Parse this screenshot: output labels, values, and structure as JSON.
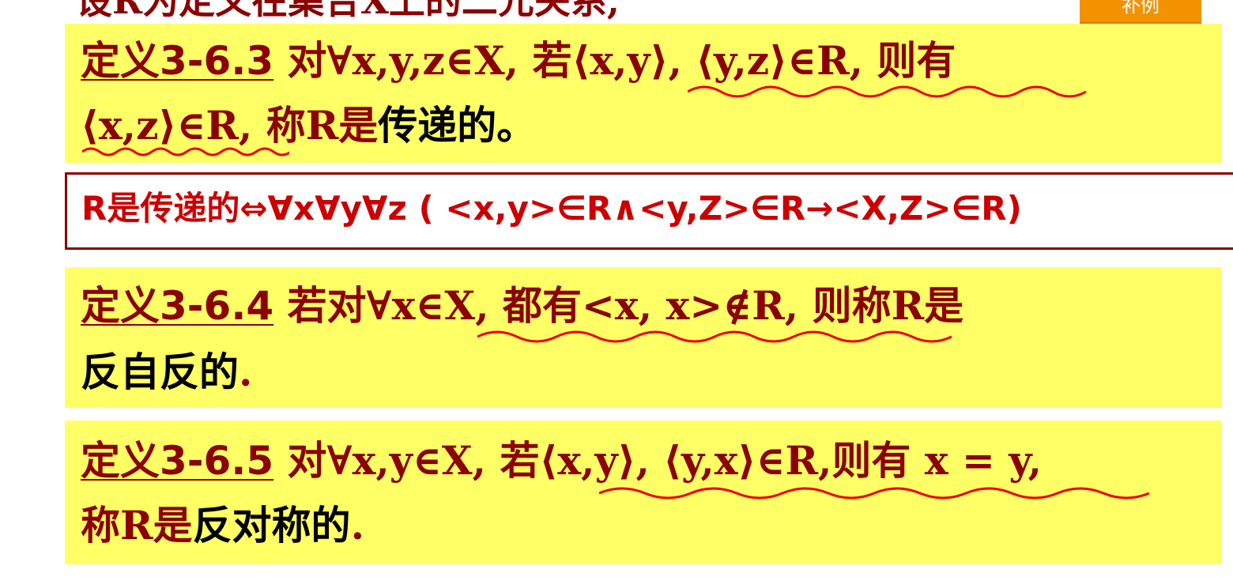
{
  "slide": {
    "top_line": "设R为定义在集合X上的二元关系,",
    "example_button": "补例"
  },
  "def_transitive": {
    "label": "定义3-6.3",
    "line1_text": " 对∀x,y,z∈X, 若⟨x,y⟩, ⟨y,z⟩∈R, 则有",
    "line2_math": "⟨x,z⟩∈R,",
    "line2_mid": " 称R是",
    "line2_term": "传递的。"
  },
  "formula": {
    "text": "R是传递的⇔∀x∀y∀z ( <x,y>∈R∧<y,Z>∈R→<X,Z>∈R)"
  },
  "def_irreflexive": {
    "label": "定义3-6.4",
    "line1_text": " 若对∀x∈X, 都有<x, x>∉R, 则称R是",
    "line2_term": "反自反的",
    "line2_end": "."
  },
  "def_antisymmetric": {
    "label": "定义3-6.5",
    "line1_text": " 对∀x,y∈X, 若⟨x,y⟩, ⟨y,x⟩∈R,则有 x = y,",
    "line2_prefix": "称R是",
    "line2_term": "反对称的",
    "line2_end": "."
  },
  "colors": {
    "highlight": "#ffff66",
    "text": "#8b0000",
    "formula": "#cc0000",
    "button": "#f39200",
    "wavy": "#ee0000"
  }
}
